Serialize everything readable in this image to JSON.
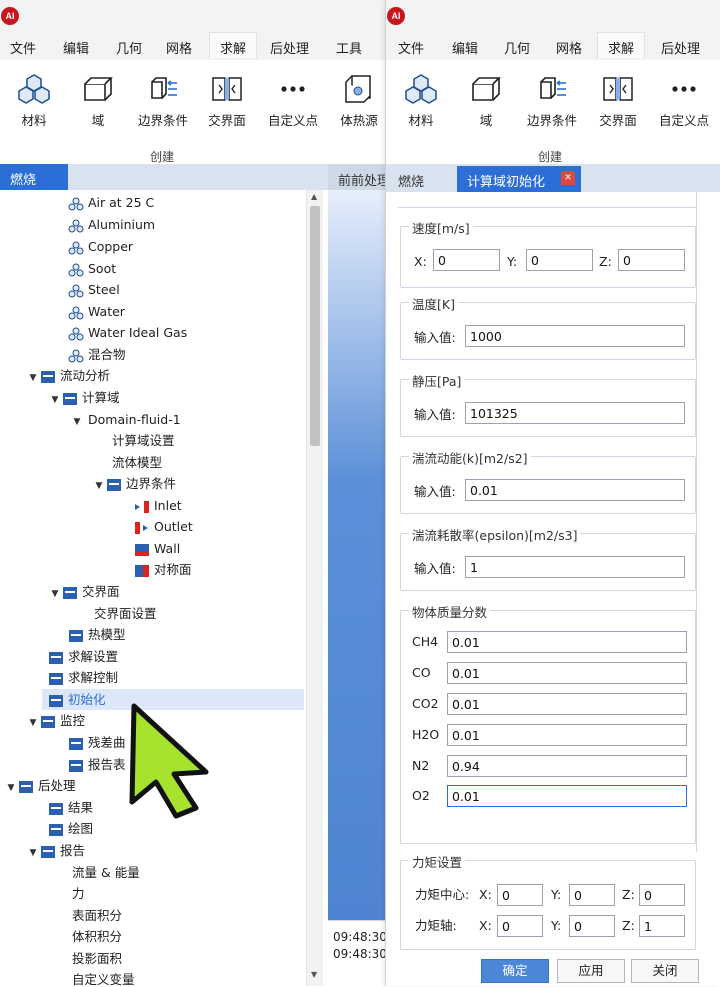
{
  "app": {
    "logo_text": "AI"
  },
  "menu": {
    "back": [
      "文件",
      "编辑",
      "几何",
      "网格",
      "求解",
      "后处理",
      "工具"
    ],
    "front": [
      "文件",
      "编辑",
      "几何",
      "网格",
      "求解",
      "后处理"
    ],
    "active": "求解"
  },
  "ribbon": {
    "buttons": [
      "材料",
      "域",
      "边界条件",
      "交界面",
      "自定义点"
    ],
    "extra_button": "体热源",
    "group_label": "创建"
  },
  "panel": {
    "tab_label": "燃烧"
  },
  "tree": {
    "materials": [
      "Air at 25 C",
      "Aluminium",
      "Copper",
      "Soot",
      "Steel",
      "Water",
      "Water Ideal Gas",
      "混合物"
    ],
    "flow_analysis": "流动分析",
    "compute_domain": "计算域",
    "domain_fluid": "Domain-fluid-1",
    "domain_settings": "计算域设置",
    "fluid_model": "流体模型",
    "boundary_conditions": "边界条件",
    "bc_items": [
      "Inlet",
      "Outlet",
      "Wall",
      "对称面"
    ],
    "interface": "交界面",
    "interface_settings": "交界面设置",
    "thermal_model": "热模型",
    "solve_settings": "求解设置",
    "solve_control": "求解控制",
    "initialization": "初始化",
    "monitor": "监控",
    "residual": "残差曲",
    "report": "报告表",
    "post": "后处理",
    "results": "结果",
    "plot": "绘图",
    "reports": "报告",
    "report_items": [
      "流量 & 能量",
      "力",
      "表面积分",
      "体积积分",
      "投影面积",
      "自定义变量"
    ]
  },
  "mid": {
    "tab_label": "前前处理",
    "log_times": [
      "09:48:30",
      "09:48:30"
    ]
  },
  "dialog": {
    "tabs": [
      "燃烧",
      "计算域初始化"
    ],
    "close_glyph": "✕",
    "velocity": {
      "title": "速度[m/s]",
      "x_label": "X:",
      "y_label": "Y:",
      "z_label": "Z:",
      "x": "0",
      "y": "0",
      "z": "0"
    },
    "temperature": {
      "title": "温度[K]",
      "label": "输入值:",
      "value": "1000"
    },
    "pressure": {
      "title": "静压[Pa]",
      "label": "输入值:",
      "value": "101325"
    },
    "tke": {
      "title": "湍流动能(k)[m2/s2]",
      "label": "输入值:",
      "value": "0.01"
    },
    "epsilon": {
      "title": "湍流耗散率(epsilon)[m2/s3]",
      "label": "输入值:",
      "value": "1"
    },
    "mass_fraction": {
      "title": "物体质量分数",
      "species": [
        {
          "name": "CH4",
          "value": "0.01"
        },
        {
          "name": "CO",
          "value": "0.01"
        },
        {
          "name": "CO2",
          "value": "0.01"
        },
        {
          "name": "H2O",
          "value": "0.01"
        },
        {
          "name": "N2",
          "value": "0.94"
        },
        {
          "name": "O2",
          "value": "0.01"
        }
      ]
    },
    "moment": {
      "title": "力矩设置",
      "center_label": "力矩中心:",
      "axis_label": "力矩轴:",
      "x_label": "X:",
      "y_label": "Y:",
      "z_label": "Z:",
      "center": [
        "0",
        "0",
        "0"
      ],
      "axis": [
        "0",
        "0",
        "1"
      ]
    },
    "buttons": {
      "ok": "确定",
      "apply": "应用",
      "close": "关闭"
    }
  },
  "colors": {
    "accent": "#2b6fd6",
    "cursor": "#a6e22e",
    "selected_row": "#dce8f7",
    "mid_panel": "#5b8fd8"
  }
}
